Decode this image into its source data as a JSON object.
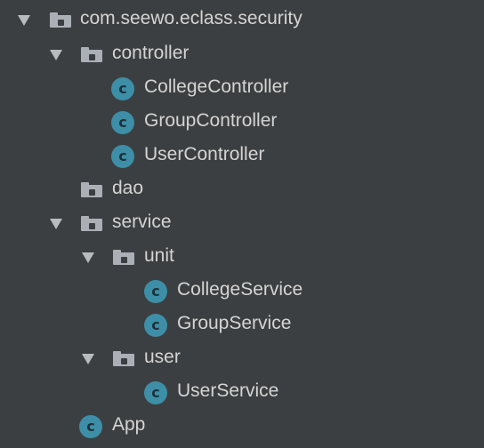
{
  "tree": {
    "root": {
      "label": "com.seewo.eclass.security",
      "icon": "package-folder-icon",
      "expanded": true
    },
    "controller": {
      "label": "controller",
      "icon": "folder-icon",
      "expanded": true
    },
    "college_controller": {
      "label": "CollegeController",
      "icon": "class-icon",
      "icon_glyph": "c"
    },
    "group_controller": {
      "label": "GroupController",
      "icon": "class-icon",
      "icon_glyph": "c"
    },
    "user_controller": {
      "label": "UserController",
      "icon": "class-icon",
      "icon_glyph": "c"
    },
    "dao": {
      "label": "dao",
      "icon": "folder-icon",
      "expanded": false
    },
    "service": {
      "label": "service",
      "icon": "folder-icon",
      "expanded": true
    },
    "unit": {
      "label": "unit",
      "icon": "folder-icon",
      "expanded": true
    },
    "college_service": {
      "label": "CollegeService",
      "icon": "class-icon",
      "icon_glyph": "c"
    },
    "group_service": {
      "label": "GroupService",
      "icon": "class-icon",
      "icon_glyph": "c"
    },
    "user": {
      "label": "user",
      "icon": "folder-icon",
      "expanded": true
    },
    "user_service": {
      "label": "UserService",
      "icon": "class-icon",
      "icon_glyph": "c"
    },
    "app": {
      "label": "App",
      "icon": "class-icon",
      "icon_glyph": "c"
    }
  },
  "colors": {
    "background": "#3c3f41",
    "text": "#d4d4d4",
    "folder_icon": "#aab0b6",
    "class_icon": "#3d8fa8",
    "arrow": "#b9bcbf"
  }
}
